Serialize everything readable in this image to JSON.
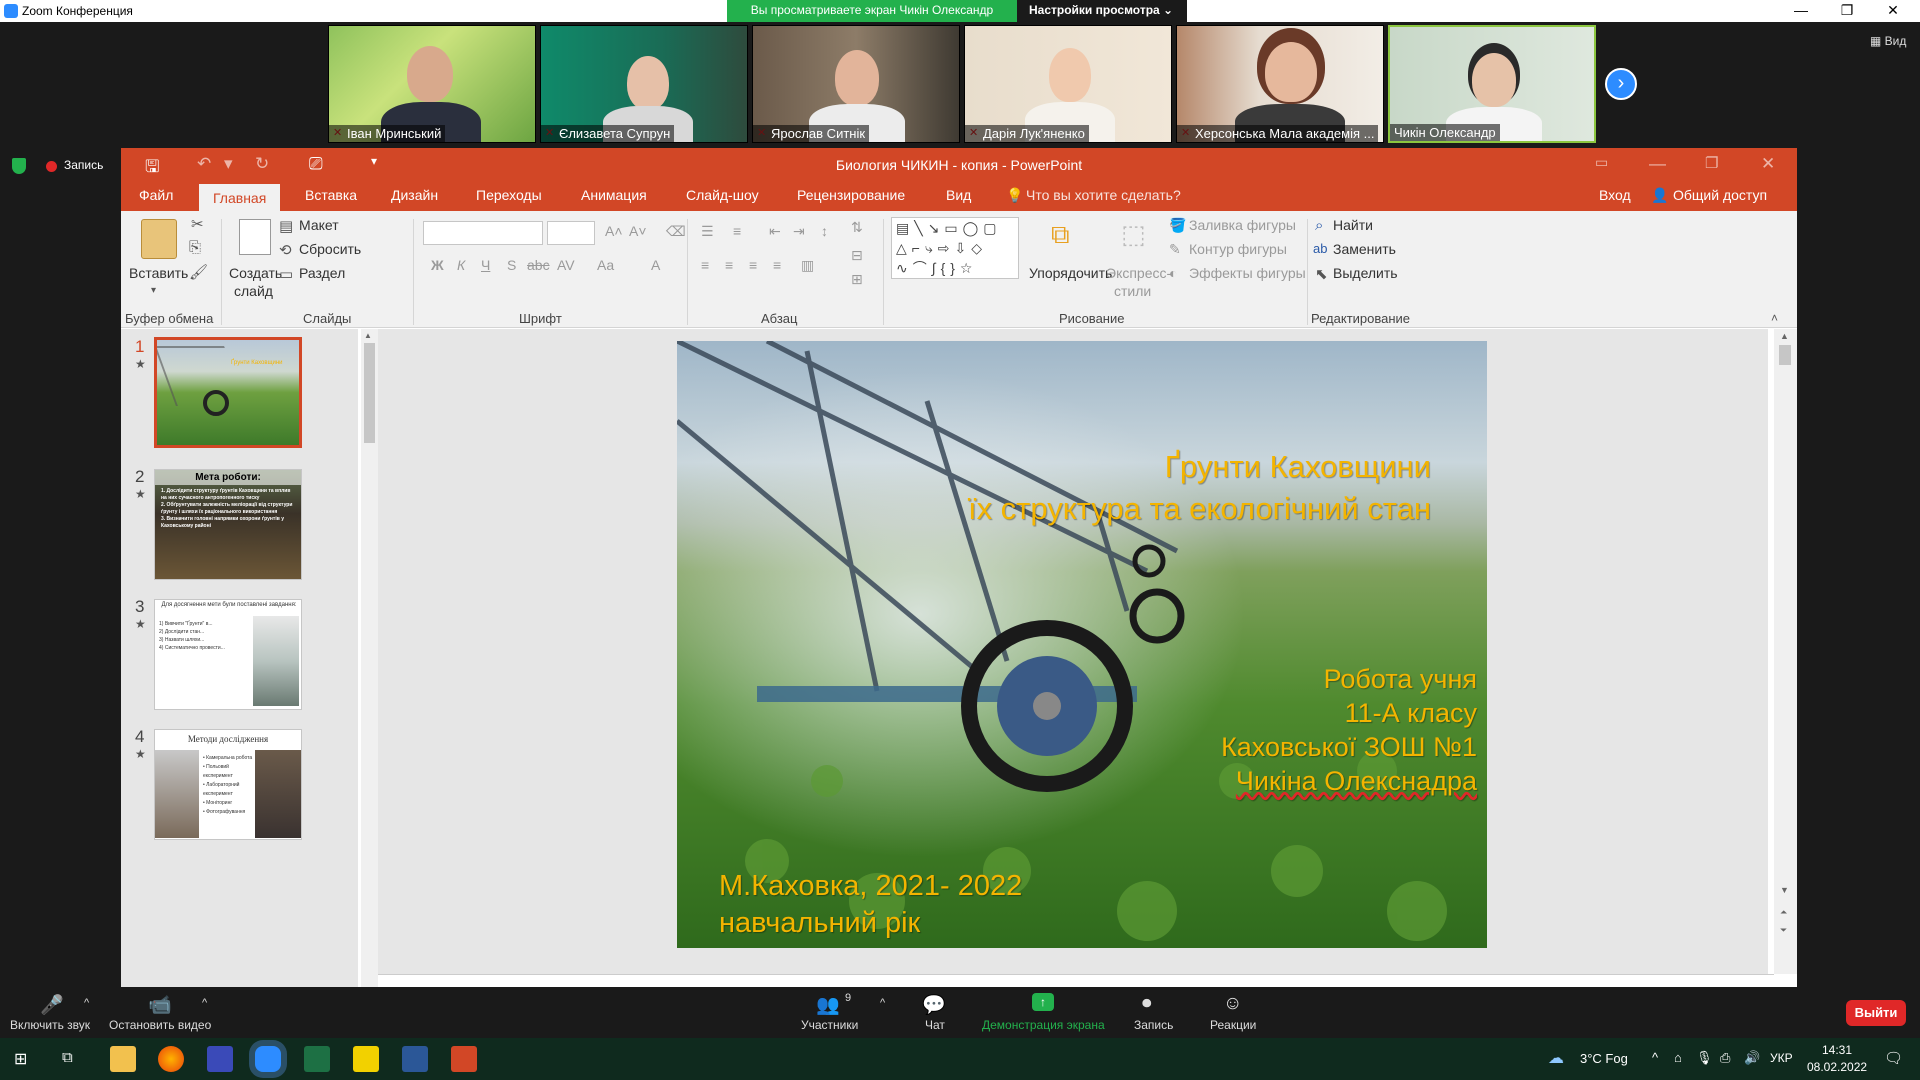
{
  "zoom": {
    "window_title": "Zoom Конференция",
    "share_banner": "Вы просматриваете экран Чикін Олександр",
    "view_options": "Настройки просмотра ⌄",
    "view_label": "Вид",
    "record_label": "Запись",
    "participants": [
      {
        "name": "Іван Мринський"
      },
      {
        "name": "Єлизавета Супрун"
      },
      {
        "name": "Ярослав Ситнік"
      },
      {
        "name": "Дарія Лук'яненко"
      },
      {
        "name": "Херсонська Мала академія ..."
      },
      {
        "name": "Чикін Олександр"
      }
    ],
    "toolbar": {
      "unmute": "Включить звук",
      "stop_video": "Остановить видео",
      "participants": "Участники",
      "participants_count": "9",
      "chat": "Чат",
      "share": "Демонстрация экрана",
      "record": "Запись",
      "reactions": "Реакции",
      "leave": "Выйти"
    },
    "colors": {
      "accent": "#2d8cff",
      "share_green": "#23b14d",
      "leave_red": "#e02828"
    }
  },
  "powerpoint": {
    "title": "Биология ЧИКИН - копия - PowerPoint",
    "tabs": [
      "Файл",
      "Главная",
      "Вставка",
      "Дизайн",
      "Переходы",
      "Анимация",
      "Слайд-шоу",
      "Рецензирование",
      "Вид"
    ],
    "tell_me": "Что вы хотите сделать?",
    "sign_in": "Вход",
    "share": "Общий доступ",
    "ribbon": {
      "paste": "Вставить",
      "clipboard": "Буфер обмена",
      "new_slide_1": "Создать",
      "new_slide_2": "слайд",
      "layout": "Макет",
      "reset": "Сбросить",
      "section": "Раздел",
      "slides": "Слайды",
      "font": "Шрифт",
      "paragraph": "Абзац",
      "arrange": "Упорядочить",
      "quick_styles_1": "Экспресс-",
      "quick_styles_2": "стили",
      "shape_fill": "Заливка фигуры",
      "shape_outline": "Контур фигуры",
      "shape_effects": "Эффекты фигуры",
      "drawing": "Рисование",
      "find": "Найти",
      "replace": "Заменить",
      "select": "Выделить",
      "editing": "Редактирование",
      "font_buttons": [
        "Ж",
        "К",
        "Ч",
        "S",
        "abc",
        "AV",
        "Aa",
        "A"
      ]
    },
    "slides": [
      {
        "number": "1",
        "title": "Ґрунти Каховщини"
      },
      {
        "number": "2",
        "title": "Мета роботи:",
        "lines": [
          "1. Дослідити структуру ґрунтів Каховщини та вплив на них сучасного антропогенного тиску",
          "2. Обґрунтувати залежність меліорації від структури ґрунту і шляхи їх раціонального використання",
          "3. Визначити головні напрямки охорони ґрунтів у Каховському районі"
        ]
      },
      {
        "number": "3",
        "title": "Для досягнення мети були поставлені завдання:",
        "lines": [
          "1) Вивчити \"Ґрунти\" в...",
          "2) Дослідити стан...",
          "3) Назвати шляхи...",
          "4) Систематично провести..."
        ]
      },
      {
        "number": "4",
        "title": "Методи дослідження",
        "lines": [
          "• Камеральна робота",
          "• Польовий експеримент",
          "• Лабораторний експеримент",
          "• Моніторинг",
          "• Фотографування"
        ]
      }
    ],
    "current_slide": {
      "title_line1": "Ґрунти Каховщини",
      "title_line2": "їх структура та екологічний стан",
      "author_line1": "Робота учня",
      "author_line2": "11-А класу",
      "author_line3": "Каховської ЗОШ №1",
      "author_line4": "Чикіна Олекснадра",
      "footer_line1": "М.Каховка, 2021- 2022",
      "footer_line2": "навчальний рік",
      "text_color": "#f4b400"
    },
    "colors": {
      "brand": "#d24726"
    }
  },
  "taskbar": {
    "weather": "3°C  Fog",
    "lang": "УКР",
    "time": "14:31",
    "date": "08.02.2022"
  }
}
